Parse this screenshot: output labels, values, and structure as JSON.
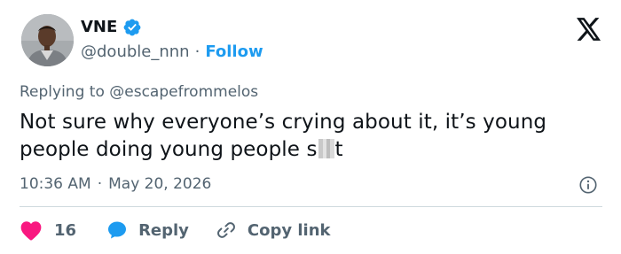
{
  "author": {
    "display_name": "VNE",
    "handle": "@double_nnn",
    "separator": "·",
    "follow_label": "Follow",
    "verified": true
  },
  "reply": {
    "prefix": "Replying to ",
    "mention": "@escapefrommelos"
  },
  "tweet": {
    "text_before_censor": "Not sure why everyone’s crying about it, it’s young people doing young people s",
    "text_after_censor": "t"
  },
  "meta": {
    "time": "10:36 AM",
    "separator": "·",
    "date": "May 20, 2026"
  },
  "actions": {
    "like_count": "16",
    "reply_label": "Reply",
    "copy_label": "Copy link"
  },
  "colors": {
    "accent": "#1d9bf0",
    "like": "#f91880",
    "text": "#0f1419",
    "muted": "#536471",
    "divider": "#cfd9de"
  },
  "icons": [
    "verified-badge-icon",
    "x-logo-icon",
    "info-icon",
    "heart-icon",
    "reply-bubble-icon",
    "link-icon"
  ]
}
